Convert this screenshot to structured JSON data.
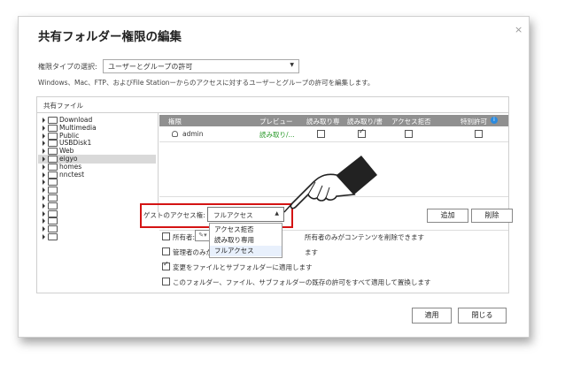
{
  "dialog": {
    "title": "共有フォルダー権限の編集",
    "close_glyph": "×"
  },
  "permission_type": {
    "label": "権限タイプの選択:",
    "selected": "ユーザーとグループの許可",
    "arrow": "▼",
    "description": "Windows、Mac、FTP、およびFile Stationーからのアクセスに対するユーザーとグループの許可を編集します。"
  },
  "shared_folders": {
    "header": "共有ファイル",
    "items": [
      "Download",
      "Multimedia",
      "Public",
      "USBDisk1",
      "Web",
      "eigyo",
      "homes",
      "nnctest",
      "",
      "",
      "",
      "",
      "",
      "",
      "",
      ""
    ],
    "selected_index": 5
  },
  "grid": {
    "columns": [
      "権限",
      "プレビュー",
      "読み取り専",
      "読み取り/書",
      "アクセス拒否",
      "特別許可"
    ],
    "info_icon": "i",
    "rows": [
      {
        "name": "admin",
        "preview": "読み取り/...",
        "read_only": false,
        "read_write": true,
        "deny": false,
        "special": false
      }
    ]
  },
  "guest_access": {
    "label": "ゲストのアクセス権:",
    "selected": "フルアクセス",
    "arrow": "▲",
    "options": [
      "アクセス拒否",
      "読み取り専用",
      "フルアクセス"
    ]
  },
  "buttons": {
    "add": "追加",
    "remove": "削除",
    "apply": "適用",
    "close": "閉じる"
  },
  "options": {
    "owner_label": "所有者:",
    "owner_value": "adm",
    "owner_note": "所有者のみがコンテンツを削除できます",
    "admin_only": "管理者のみがファイ",
    "admin_only_tail": "ます",
    "apply_subfolders": "変更をファイルとサブフォルダーに適用します",
    "apply_all": "このフォルダー、ファイル、サブフォルダーの既存の許可をすべて適用して置換します",
    "apply_subfolders_checked": true
  }
}
